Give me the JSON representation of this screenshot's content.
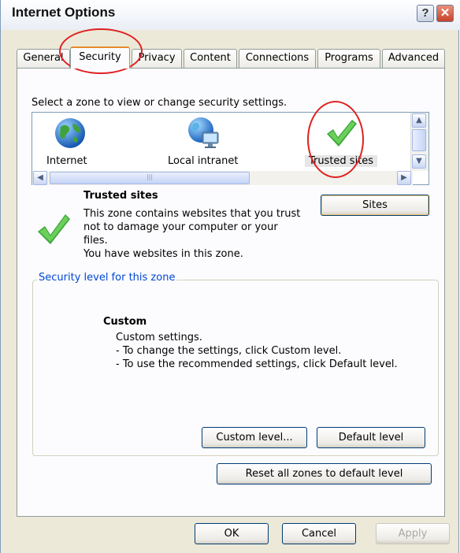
{
  "window": {
    "title": "Internet Options"
  },
  "title_buttons": {
    "help": "?",
    "close": "✕"
  },
  "tabs": [
    {
      "label": "General"
    },
    {
      "label": "Security",
      "active": true
    },
    {
      "label": "Privacy"
    },
    {
      "label": "Content"
    },
    {
      "label": "Connections"
    },
    {
      "label": "Programs"
    },
    {
      "label": "Advanced"
    }
  ],
  "zones": {
    "prompt": "Select a zone to view or change security settings.",
    "items": [
      {
        "label": "Internet",
        "icon": "globe-icon"
      },
      {
        "label": "Local intranet",
        "icon": "network-globe-icon"
      },
      {
        "label": "Trusted sites",
        "icon": "checkmark-icon",
        "selected": true
      }
    ]
  },
  "zone_info": {
    "title": "Trusted sites",
    "description": "This zone contains websites that you trust not to damage your computer or your files.",
    "status": "You have websites in this zone.",
    "sites_button": "Sites"
  },
  "security_level": {
    "legend": "Security level for this zone",
    "level_title": "Custom",
    "lines": [
      "Custom settings.",
      "- To change the settings, click Custom level.",
      "- To use the recommended settings, click Default level."
    ],
    "custom_level_button": "Custom level...",
    "default_level_button": "Default level"
  },
  "reset_button": "Reset all zones to default level",
  "footer": {
    "ok": "OK",
    "cancel": "Cancel",
    "apply": "Apply"
  },
  "colors": {
    "annotation": "#e02020",
    "check": "#3aa63a",
    "link_blue": "#0046d5"
  }
}
